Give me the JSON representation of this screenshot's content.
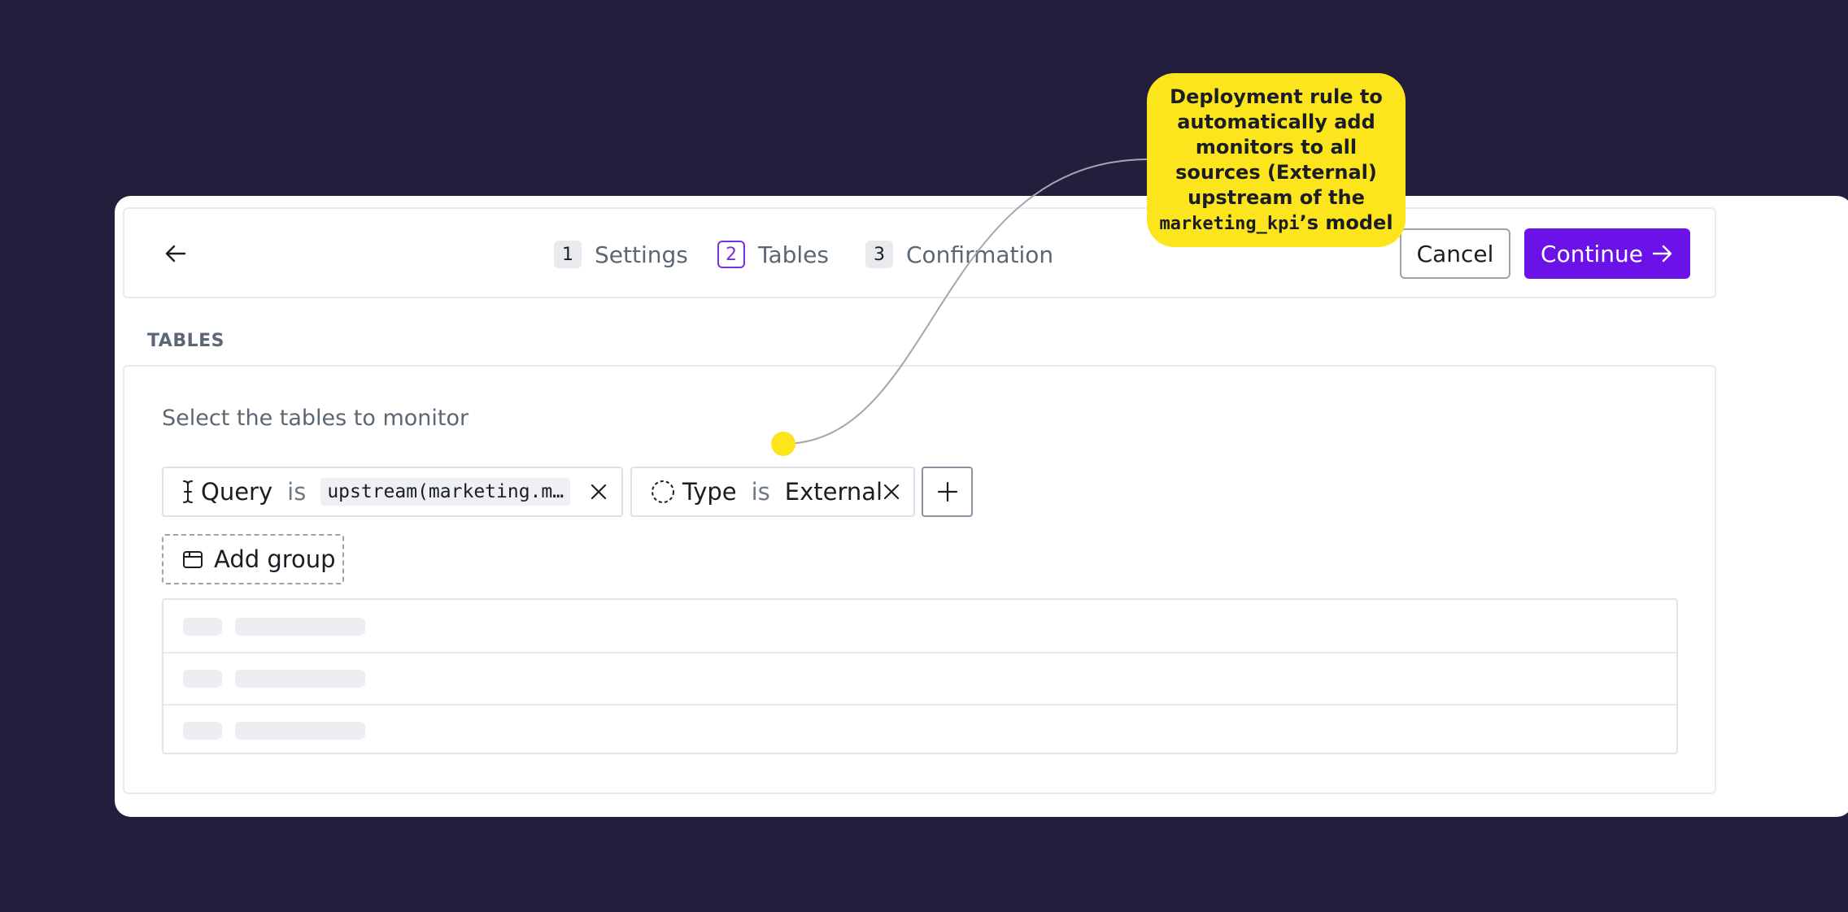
{
  "header": {
    "steps": [
      {
        "number": "1",
        "label": "Settings",
        "active": false
      },
      {
        "number": "2",
        "label": "Tables",
        "active": true
      },
      {
        "number": "3",
        "label": "Confirmation",
        "active": false
      }
    ],
    "cancel_label": "Cancel",
    "continue_label": "Continue"
  },
  "section": {
    "title": "TABLES",
    "prompt": "Select the tables to monitor"
  },
  "filters": [
    {
      "field": "Query",
      "operator": "is",
      "value": "upstream(marketing.m…",
      "icon": "text-cursor-icon"
    },
    {
      "field": "Type",
      "operator": "is",
      "value": "External",
      "icon": "dashed-circle-icon"
    }
  ],
  "add_group_label": "Add group",
  "callout": {
    "line1": "Deployment rule to automatically add monitors to all sources (External) upstream of the",
    "code": "marketing_kpi",
    "line2": "’s model"
  },
  "colors": {
    "background": "#241e3d",
    "accent": "#6b12e8",
    "callout": "#fde51d"
  }
}
